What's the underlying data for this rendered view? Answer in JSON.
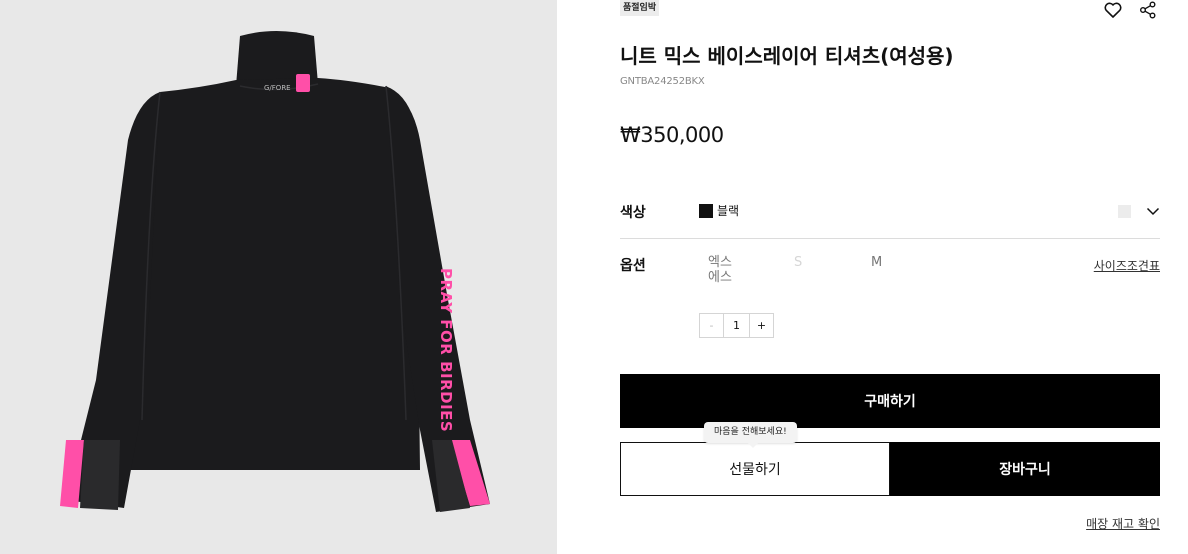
{
  "product": {
    "badge": "품절임박",
    "title": "니트 믹스 베이스레이어 티셔츠(여성용)",
    "code": "GNTBA24252BKX",
    "price": "₩350,000",
    "image": {
      "background": "#e8e8e8",
      "garment_color": "#1b1b1d",
      "accent_color": "#ff4fa8",
      "sleeve_text": "PRAY FOR BIRDIES",
      "collar_logo": "G/FORE"
    }
  },
  "icons": {
    "wishlist": "heart-icon",
    "share": "share-icon",
    "dropdown": "chevron-down-icon"
  },
  "color": {
    "label": "색상",
    "selected": "블랙",
    "swatch": "#111111"
  },
  "options": {
    "label": "옵션",
    "sizes": [
      {
        "line1": "엑스",
        "line2": "에스",
        "available": true
      },
      {
        "line1": "S",
        "line2": "",
        "available": false
      },
      {
        "line1": "M",
        "line2": "",
        "available": true
      }
    ],
    "size_guide": "사이즈조견표"
  },
  "quantity": {
    "minus": "-",
    "value": "1",
    "plus": "+"
  },
  "actions": {
    "buy": "구매하기",
    "gift": "선물하기",
    "gift_tooltip": "마음을 전해보세요!",
    "cart": "장바구니",
    "store_stock": "매장 재고 확인"
  }
}
